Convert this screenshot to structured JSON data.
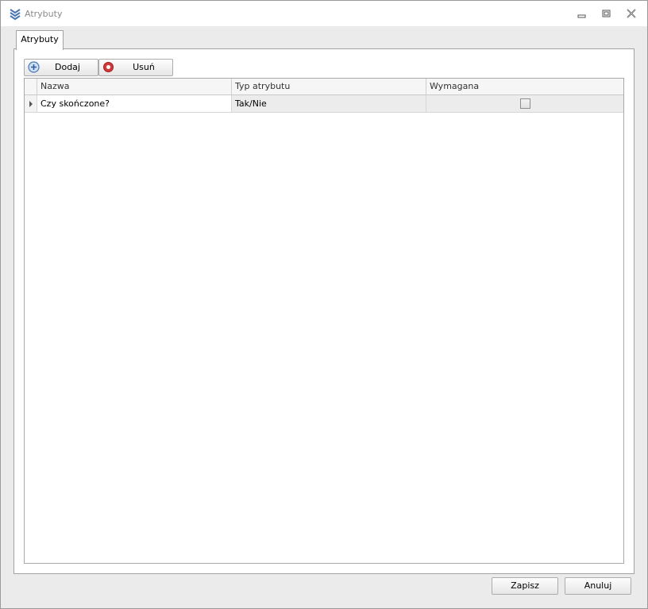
{
  "window": {
    "title": "Atrybuty",
    "app_icon": "chevrons-down-icon"
  },
  "tabs": [
    {
      "label": "Atrybuty",
      "active": true
    }
  ],
  "toolbar": {
    "add_label": "Dodaj",
    "add_icon": "plus-circle-icon",
    "delete_label": "Usuń",
    "delete_icon": "stop-circle-icon"
  },
  "grid": {
    "columns": [
      "Nazwa",
      "Typ atrybutu",
      "Wymagana"
    ],
    "rows": [
      {
        "name": "Czy skończone?",
        "type": "Tak/Nie",
        "required": false
      }
    ]
  },
  "footer": {
    "save_label": "Zapisz",
    "cancel_label": "Anuluj"
  },
  "colors": {
    "accent": "#4a77b4",
    "delete_red": "#d23a3a",
    "window_bg": "#ebebeb"
  }
}
